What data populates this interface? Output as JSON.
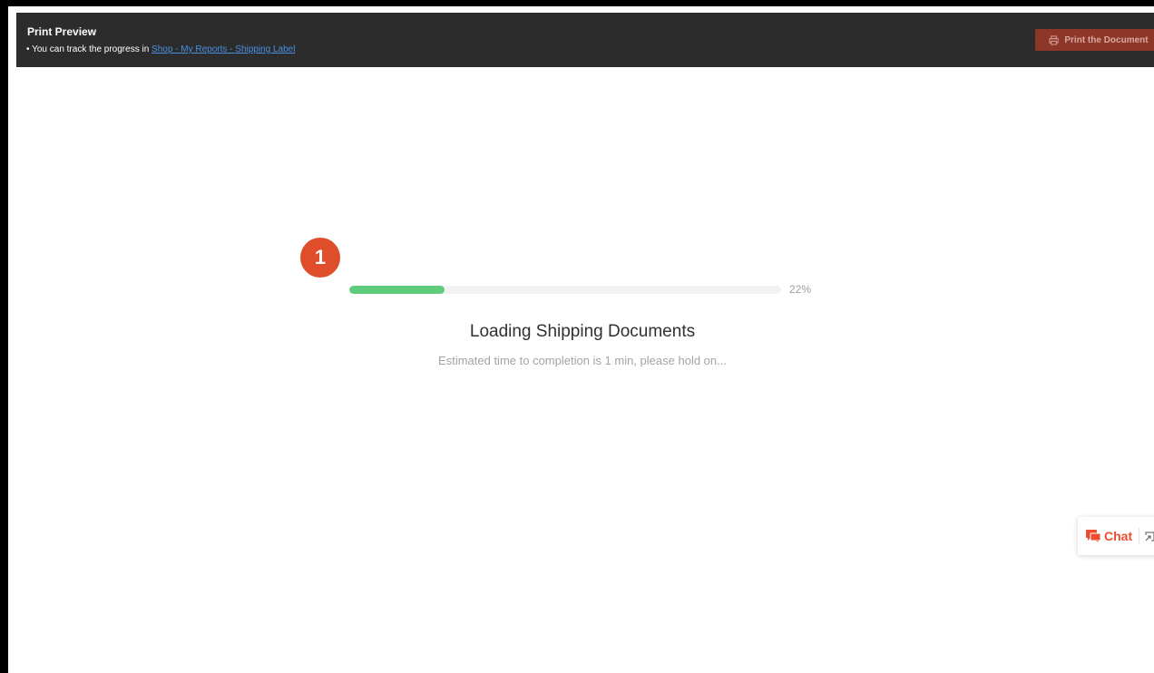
{
  "header": {
    "title": "Print Preview",
    "track_prefix": "• You can track the progress in ",
    "track_link": "Shop - My Reports - Shipping Label",
    "print_button_label": "Print the Document",
    "print_icon": "printer-icon"
  },
  "step_badge": "1",
  "progress": {
    "value": 0.22,
    "label": "22%"
  },
  "loading": {
    "title": "Loading Shipping Documents",
    "subtitle": "Estimated time to completion is 1 min, please hold on..."
  },
  "chat": {
    "label": "Chat",
    "icon": "chat-icon",
    "popout_icon": "popout-icon"
  },
  "colors": {
    "topbar_bg": "#2c2c2c",
    "link": "#4a8fe0",
    "print_button_bg": "#8e3729",
    "badge": "#e04d2a",
    "progress_fill": "#5ecc7a",
    "chat_accent": "#ee4d2d"
  }
}
